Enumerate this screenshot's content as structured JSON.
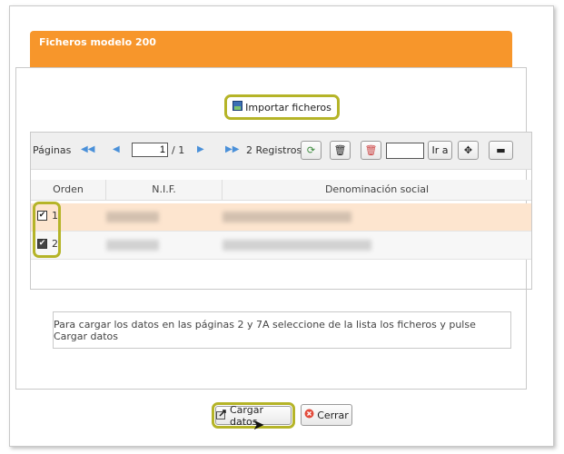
{
  "window": {
    "title": "Ficheros modelo 200"
  },
  "import_button": {
    "label": "Importar ficheros",
    "icon": "import-icon"
  },
  "toolbar": {
    "pages_label": "Páginas",
    "current_page": "1",
    "total_pages": "/ 1",
    "records": "2 Registros",
    "goto_label": "Ir a"
  },
  "grid": {
    "columns": [
      "Orden",
      "N.I.F.",
      "Denominación social"
    ],
    "rows": [
      {
        "orden": "1",
        "checked": true
      },
      {
        "orden": "2",
        "checked": true
      }
    ]
  },
  "info_text": "Para cargar los datos en las páginas 2 y 7A seleccione de la lista los ficheros y pulse Cargar datos",
  "footer": {
    "load_label": "Cargar datos",
    "close_label": "Cerrar"
  },
  "colors": {
    "accent": "#f7962b",
    "highlight": "#b5b428",
    "selected_row": "#fde5cf"
  }
}
